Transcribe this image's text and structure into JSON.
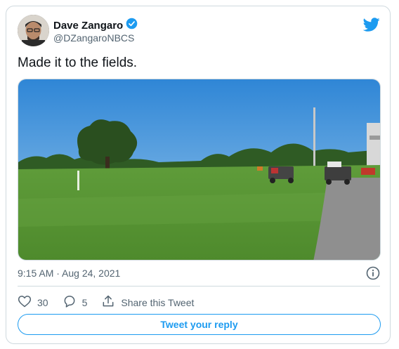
{
  "user": {
    "name": "Dave Zangaro",
    "handle": "@DZangaroNBCS",
    "verified": true
  },
  "tweet": {
    "text": "Made it to the fields.",
    "timestamp": "9:15 AM · Aug 24, 2021"
  },
  "actions": {
    "likes": "30",
    "replies": "5",
    "share_label": "Share this Tweet"
  },
  "reply_button_label": "Tweet your reply",
  "colors": {
    "accent": "#1d9bf0",
    "text": "#0f1419",
    "muted": "#536471",
    "border": "#cfd9de"
  },
  "icons": [
    "verified-badge-icon",
    "twitter-bird-icon",
    "info-icon",
    "heart-icon",
    "reply-icon",
    "share-icon"
  ]
}
